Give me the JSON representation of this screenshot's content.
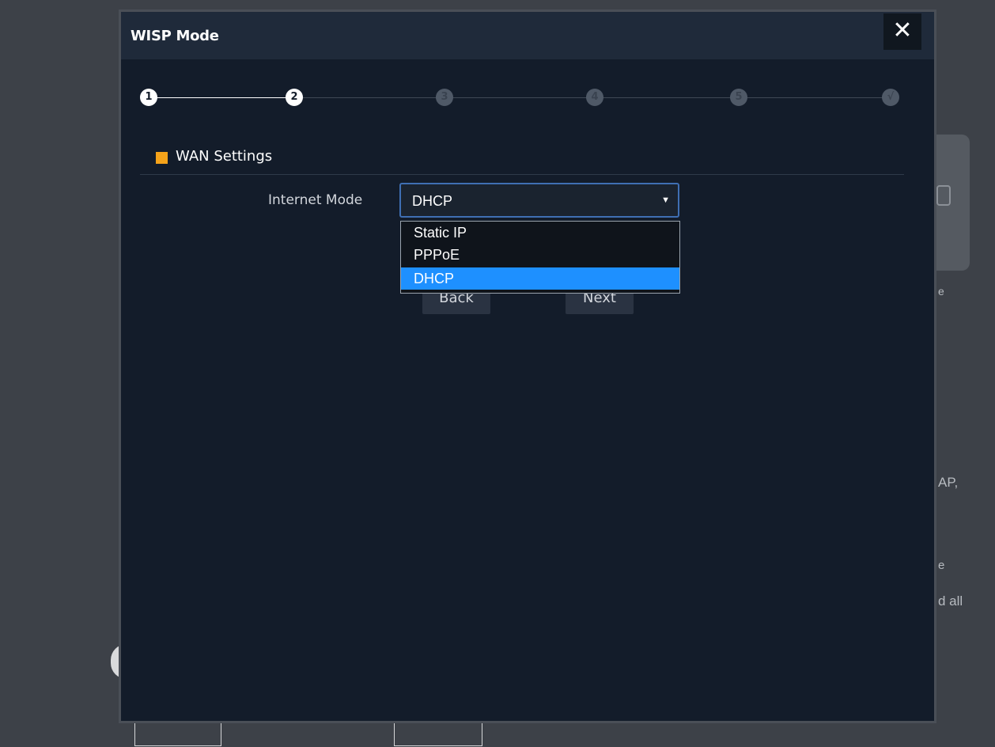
{
  "background": {
    "text_fragments": [
      "e",
      "AP,",
      "e",
      "d all"
    ]
  },
  "modal": {
    "title": "WISP Mode",
    "close_icon": "close-icon",
    "close_glyph": "✕"
  },
  "stepper": {
    "steps": [
      {
        "label": "1",
        "state": "completed"
      },
      {
        "label": "2",
        "state": "current"
      },
      {
        "label": "3",
        "state": "pending"
      },
      {
        "label": "4",
        "state": "pending"
      },
      {
        "label": "5",
        "state": "pending"
      },
      {
        "label": "√",
        "state": "pending"
      }
    ],
    "active_color": "#ffffff",
    "inactive_color": "#4f5967"
  },
  "section": {
    "title": "WAN Settings",
    "marker_color": "#f5a31a"
  },
  "form": {
    "internet_mode_label": "Internet Mode",
    "internet_mode_value": "DHCP",
    "arrow_glyph": "▼",
    "options": [
      {
        "label": "Static IP",
        "selected": false
      },
      {
        "label": "PPPoE",
        "selected": false
      },
      {
        "label": "DHCP",
        "selected": true
      }
    ],
    "selected_color": "#1e90ff"
  },
  "actions": {
    "back_label": "Back",
    "next_label": "Next"
  }
}
